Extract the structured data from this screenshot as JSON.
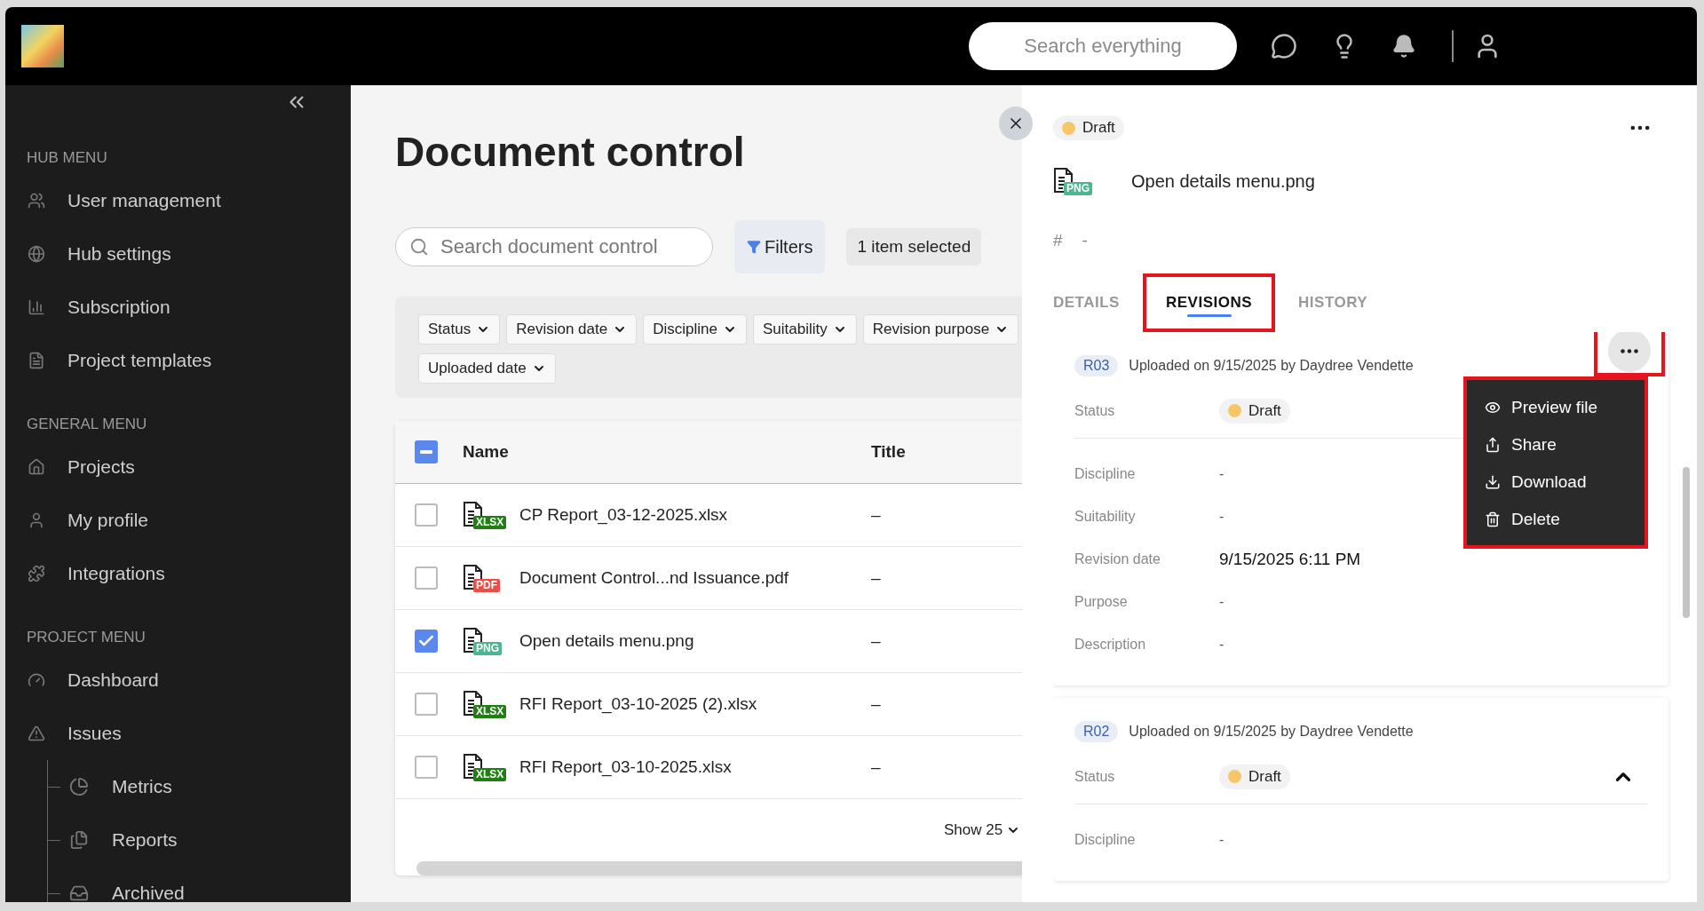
{
  "header": {
    "search_placeholder": "Search everything"
  },
  "sidebar": {
    "sections": [
      {
        "title": "HUB MENU",
        "items": [
          {
            "label": "User management"
          },
          {
            "label": "Hub settings"
          },
          {
            "label": "Subscription"
          },
          {
            "label": "Project templates"
          }
        ]
      },
      {
        "title": "GENERAL MENU",
        "items": [
          {
            "label": "Projects"
          },
          {
            "label": "My profile"
          },
          {
            "label": "Integrations"
          }
        ]
      },
      {
        "title": "PROJECT MENU",
        "items": [
          {
            "label": "Dashboard"
          },
          {
            "label": "Issues",
            "children": [
              {
                "label": "Metrics"
              },
              {
                "label": "Reports"
              },
              {
                "label": "Archived"
              }
            ]
          }
        ]
      }
    ]
  },
  "main": {
    "title": "Document control",
    "search_placeholder": "Search document control",
    "filters_button": "Filters",
    "selection_label": "1 item selected",
    "filter_chips": [
      "Status",
      "Revision date",
      "Discipline",
      "Suitability",
      "Revision purpose",
      "Uploaded date"
    ],
    "table": {
      "header_indeterminate": true,
      "columns": [
        "Name",
        "Title"
      ],
      "rows": [
        {
          "name": "CP Report_03-12-2025.xlsx",
          "file_type": "XLSX",
          "color": "#1f7f12",
          "title": "–",
          "selected": false
        },
        {
          "name": "Document Control...nd Issuance.pdf",
          "file_type": "PDF",
          "color": "#ec4e45",
          "title": "–",
          "selected": false
        },
        {
          "name": "Open details menu.png",
          "file_type": "PNG",
          "color": "#4db690",
          "title": "–",
          "selected": true
        },
        {
          "name": "RFI Report_03-10-2025 (2).xlsx",
          "file_type": "XLSX",
          "color": "#1f7f12",
          "title": "–",
          "selected": false
        },
        {
          "name": "RFI Report_03-10-2025.xlsx",
          "file_type": "XLSX",
          "color": "#1f7f12",
          "title": "–",
          "selected": false
        }
      ],
      "page_size": "Show 25"
    }
  },
  "panel": {
    "status": {
      "label": "Draft",
      "color": "#f6c667"
    },
    "file_name": "Open details menu.png",
    "file_badge": {
      "label": "PNG",
      "color": "#4db690"
    },
    "number_label": "#",
    "number_value": "-",
    "tabs": [
      {
        "label": "DETAILS",
        "selected": false,
        "highlighted": false
      },
      {
        "label": "REVISIONS",
        "selected": true,
        "highlighted": true
      },
      {
        "label": "HISTORY",
        "selected": false,
        "highlighted": false
      }
    ],
    "revisions": [
      {
        "code": "R03",
        "uploaded": "Uploaded on 9/15/2025 by Daydree Vendette",
        "status_label": "Status",
        "status": {
          "label": "Draft",
          "color": "#f6c667"
        },
        "menu_open": true,
        "menu_highlighted": true,
        "fields": [
          {
            "label": "Discipline",
            "value": "-"
          },
          {
            "label": "Suitability",
            "value": "-"
          },
          {
            "label": "Revision date",
            "value": "9/15/2025 6:11 PM"
          },
          {
            "label": "Purpose",
            "value": "-"
          },
          {
            "label": "Description",
            "value": "-"
          }
        ]
      },
      {
        "code": "R02",
        "uploaded": "Uploaded on 9/15/2025 by Daydree Vendette",
        "status_label": "Status",
        "status": {
          "label": "Draft",
          "color": "#f6c667"
        },
        "menu_open": false,
        "expanded": true,
        "fields": [
          {
            "label": "Discipline",
            "value": "-"
          }
        ]
      }
    ],
    "menu": [
      {
        "label": "Preview file"
      },
      {
        "label": "Share"
      },
      {
        "label": "Download"
      },
      {
        "label": "Delete"
      }
    ]
  }
}
